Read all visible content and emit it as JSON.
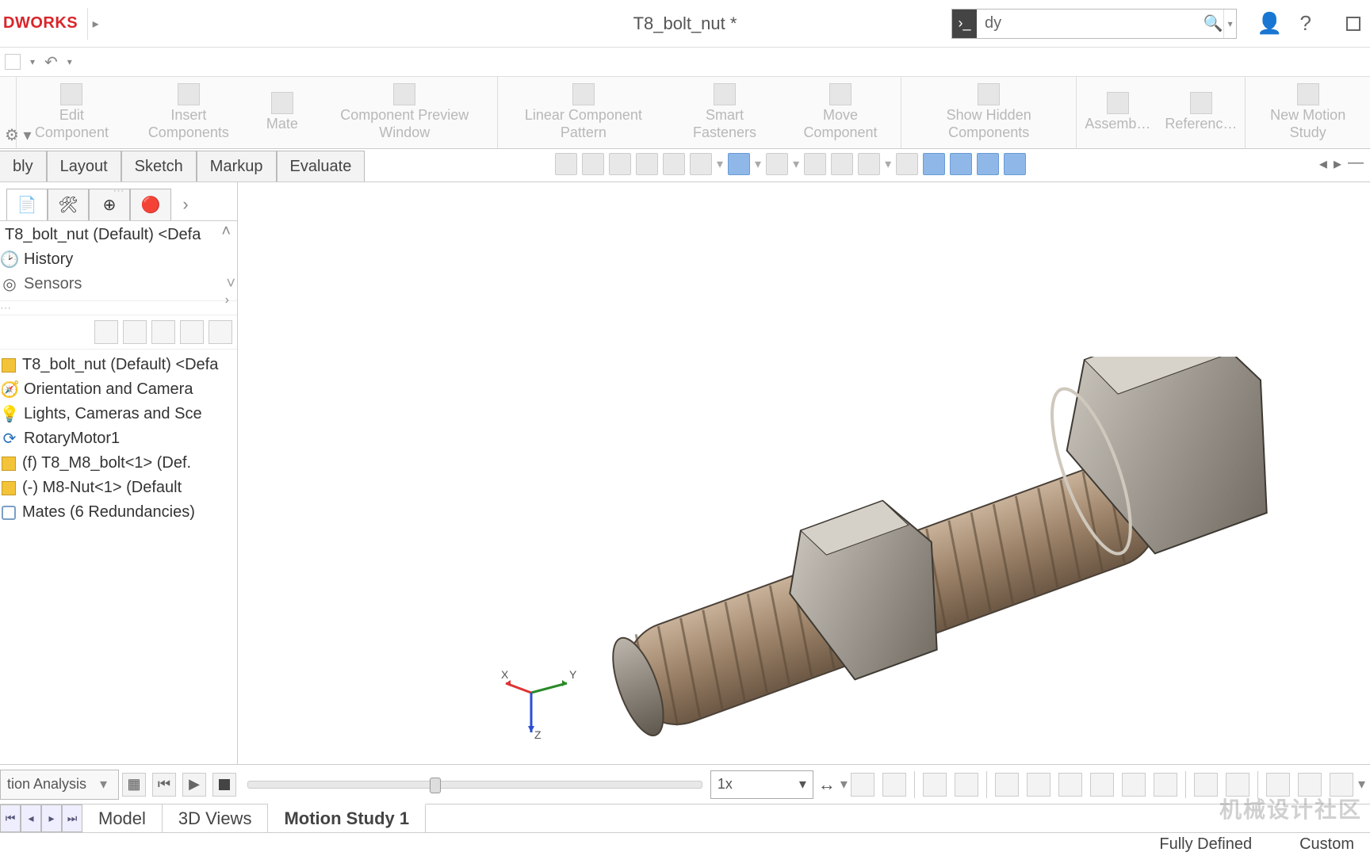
{
  "app": {
    "name": "DWORKS",
    "doc_title": "T8_bolt_nut *"
  },
  "search": {
    "prefix_glyph": "⌘",
    "value": "dy",
    "placeholder": ""
  },
  "ribbon": {
    "groups": [
      [
        "Edit Component",
        "Insert Components",
        "Mate",
        "Component Preview Window"
      ],
      [
        "Linear Component Pattern",
        "Smart Fasteners",
        "Move Component"
      ],
      [
        "Show Hidden Components"
      ],
      [
        "Assemb…",
        "Referenc…"
      ],
      [
        "New Motion Study"
      ]
    ]
  },
  "tabs": [
    "bly",
    "Layout",
    "Sketch",
    "Markup",
    "Evaluate"
  ],
  "feature_tree_top": {
    "root": "T8_bolt_nut (Default) <Defa",
    "history": "History",
    "sensors": "Sensors"
  },
  "feature_tree": {
    "root": "T8_bolt_nut (Default) <Defa",
    "items": [
      {
        "icon": "camera",
        "label": "Orientation and Camera"
      },
      {
        "icon": "light",
        "label": "Lights, Cameras and Sce"
      },
      {
        "icon": "motor",
        "label": "RotaryMotor1"
      },
      {
        "icon": "part",
        "label": "(f) T8_M8_bolt<1> (Def."
      },
      {
        "icon": "part",
        "label": "(-) M8-Nut<1> (Default"
      },
      {
        "icon": "mate",
        "label": "Mates (6 Redundancies)"
      }
    ]
  },
  "triad": {
    "x": "X",
    "y": "Y",
    "z": "Z"
  },
  "motion": {
    "analysis_label": "tion Analysis",
    "speed": "1x"
  },
  "bottom_tabs": [
    "Model",
    "3D Views",
    "Motion Study 1"
  ],
  "status": {
    "state": "Fully Defined",
    "config": "Custom"
  },
  "watermark": "机械设计社区"
}
